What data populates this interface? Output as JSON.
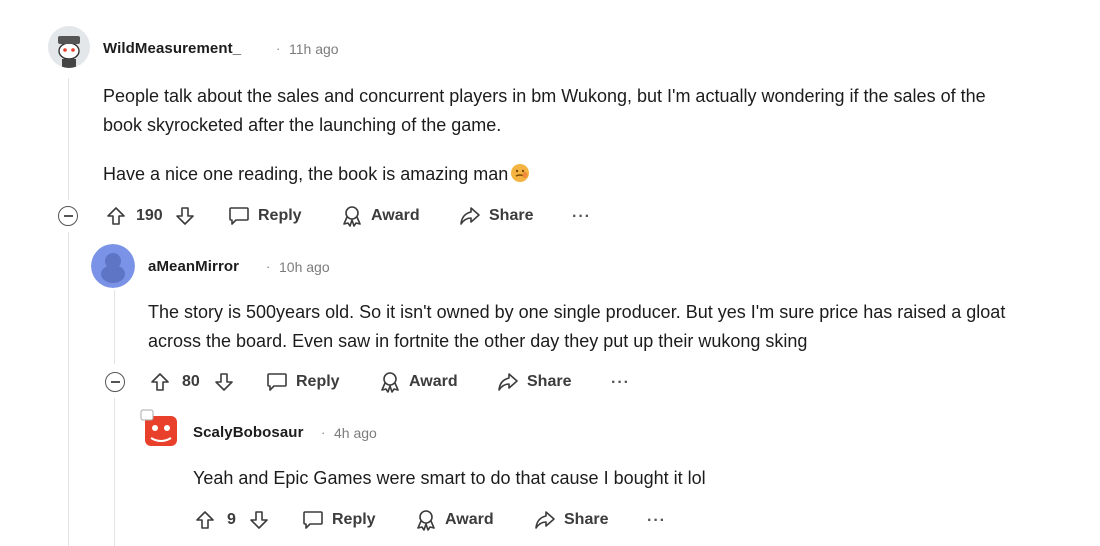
{
  "comments": [
    {
      "username": "WildMeasurement_",
      "separator": "·",
      "time": "11h ago",
      "paragraphs": [
        "People talk about the sales and concurrent players in bm Wukong, but I'm actually wondering if the sales of the",
        "book skyrocketed after the launching of the game.",
        "Have a nice one reading, the book is amazing man"
      ],
      "votes": "190",
      "reply_label": "Reply",
      "award_label": "Award",
      "share_label": "Share",
      "more_label": "···"
    },
    {
      "username": "aMeanMirror",
      "separator": "·",
      "time": "10h ago",
      "paragraphs": [
        "The story is 500years old. So it isn't owned by one single producer. But yes I'm sure price has raised a gloat",
        "across the board. Even saw in fortnite the other day they put up their wukong sking"
      ],
      "votes": "80",
      "reply_label": "Reply",
      "award_label": "Award",
      "share_label": "Share",
      "more_label": "···"
    },
    {
      "username": "ScalyBobosaur",
      "separator": "·",
      "time": "4h ago",
      "paragraphs": [
        "Yeah and Epic Games were smart to do that cause I bought it lol"
      ],
      "votes": "9",
      "reply_label": "Reply",
      "award_label": "Award",
      "share_label": "Share",
      "more_label": "···"
    }
  ],
  "icons": {
    "upvote": "upvote-arrow-icon",
    "downvote": "downvote-arrow-icon",
    "reply": "speech-bubble-icon",
    "award": "award-ribbon-icon",
    "share": "share-arrow-icon",
    "collapse": "collapse-minus-icon",
    "emoji": "face-emoji-icon"
  },
  "colors": {
    "text": "#1c1c1c",
    "meta": "#7c7c7c",
    "action": "#3c3c3c",
    "thread_line": "#e3e3e3",
    "avatar_blue": "#7a93e6",
    "avatar_red": "#e8402b"
  }
}
